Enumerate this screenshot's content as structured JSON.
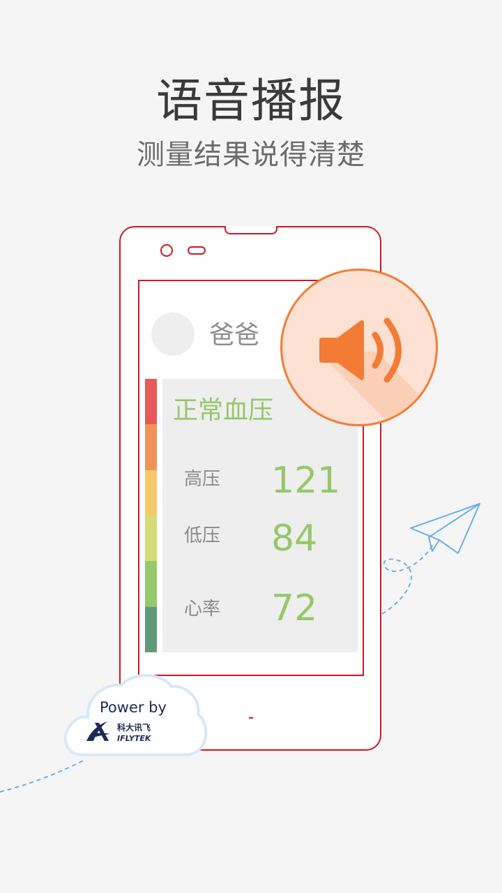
{
  "header": {
    "title": "语音播报",
    "subtitle": "测量结果说得清楚"
  },
  "screen": {
    "user_name": "爸爸",
    "status": "正常血压",
    "readings": [
      {
        "label": "高压",
        "value": "121"
      },
      {
        "label": "低压",
        "value": "84"
      },
      {
        "label": "心率",
        "value": "72"
      }
    ],
    "scale_colors": [
      "#e85a5a",
      "#f0935a",
      "#f6c86a",
      "#d6dc76",
      "#96c86c",
      "#619a7a"
    ]
  },
  "speaker_button": {
    "icon": "speaker-volume-icon",
    "color": "#f47b36"
  },
  "branding": {
    "power_label": "Power by",
    "logo_cn": "科大讯飞",
    "logo_en": "IFLYTEK"
  },
  "colors": {
    "phone_outline": "#d0161c",
    "accent_green": "#95c76a",
    "accent_orange": "#f47b36",
    "plane_blue": "#6aaeea"
  }
}
